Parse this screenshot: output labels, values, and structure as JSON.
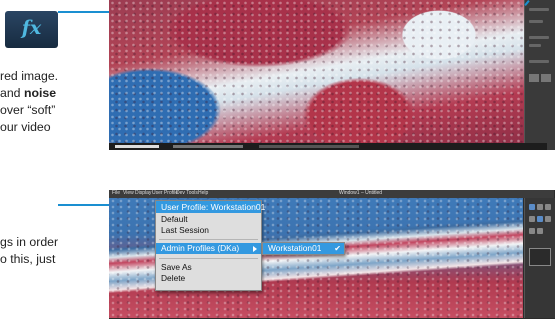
{
  "doc": {
    "fx_icon": "fx",
    "para1": {
      "line1": "red image.",
      "line2_pre": "and ",
      "line2_bold": "noise",
      "line3": "over “soft”",
      "line4": "our video"
    },
    "para2": {
      "line1": "gs in order",
      "line2": "o this, just"
    }
  },
  "menu": {
    "title": "User Profile: Workstation01",
    "items": [
      "Default",
      "Last Session",
      "Admin Profiles (DKa)",
      "Save As",
      "Delete"
    ],
    "submenu_item": "Workstation01",
    "checkmark": "✔"
  },
  "app_menubar": [
    "File",
    "View",
    "Display",
    "User Profile",
    "Dev Tools",
    "Help"
  ],
  "app_titlebar": "Window1 – Untitled",
  "colors": {
    "accent": "#3399e0",
    "connector": "#1a8fd1",
    "menu_bg": "#dedede",
    "icon_bg": "#1f3550",
    "icon_fg": "#4fb8e0"
  },
  "icons": [
    "fx-icon",
    "chevron-right-icon",
    "check-icon"
  ]
}
